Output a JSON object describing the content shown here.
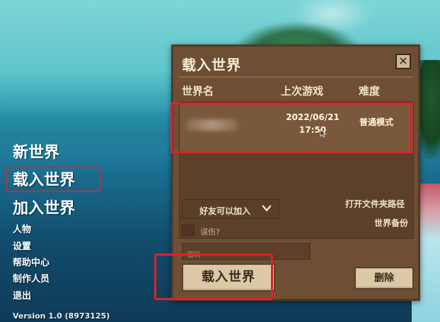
{
  "menu": {
    "new_world": "新世界",
    "load_world": "载入世界",
    "join_world": "加入世界",
    "character": "人物",
    "settings": "设置",
    "help_center": "帮助中心",
    "credits": "制作人员",
    "exit": "退出",
    "version": "Version 1.0 (8973125)"
  },
  "dialog": {
    "title": "载入世界",
    "close_icon": "close-icon",
    "columns": {
      "name": "世界名",
      "last_played": "上次游戏",
      "difficulty": "难度"
    },
    "worlds": [
      {
        "name": "",
        "date": "2022/06/21",
        "time": "17:50",
        "difficulty": "普通模式"
      }
    ],
    "privacy_dropdown": "好友可以加入",
    "open_folder": "打开文件夹路径",
    "backup": "世界备份",
    "friendly_fire": "误伤?",
    "password_placeholder": "密码",
    "load_button": "载入世界",
    "delete_button": "删除"
  },
  "colors": {
    "highlight": "#e0202a",
    "panel": "#6e4f35",
    "button": "#dcc8a6"
  }
}
